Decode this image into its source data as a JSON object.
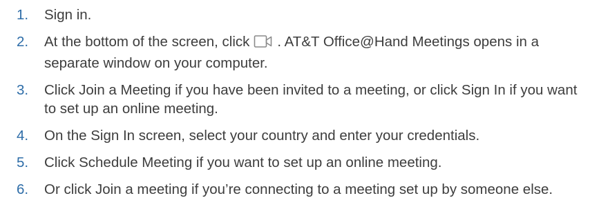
{
  "steps": [
    {
      "number": "1.",
      "text": "Sign in."
    },
    {
      "number": "2.",
      "text_before": "At the bottom of the screen, click",
      "icon": "video-camera-icon",
      "text_after": ". AT&T Office@Hand Meetings opens in a separate window on your computer."
    },
    {
      "number": "3.",
      "text": "Click Join a Meeting if you have been invited to a meeting, or click Sign In if you want to set up an online meeting."
    },
    {
      "number": "4.",
      "text": "On the Sign In screen, select your country and enter your credentials."
    },
    {
      "number": "5.",
      "text": "Click Schedule Meeting if you want to set up an online meeting."
    },
    {
      "number": "6.",
      "text": "Or click Join a meeting if you’re connecting to a meeting set up by someone else."
    }
  ],
  "colors": {
    "number": "#2e6da8",
    "text": "#3d3d3d",
    "icon": "#8a8a8a"
  }
}
